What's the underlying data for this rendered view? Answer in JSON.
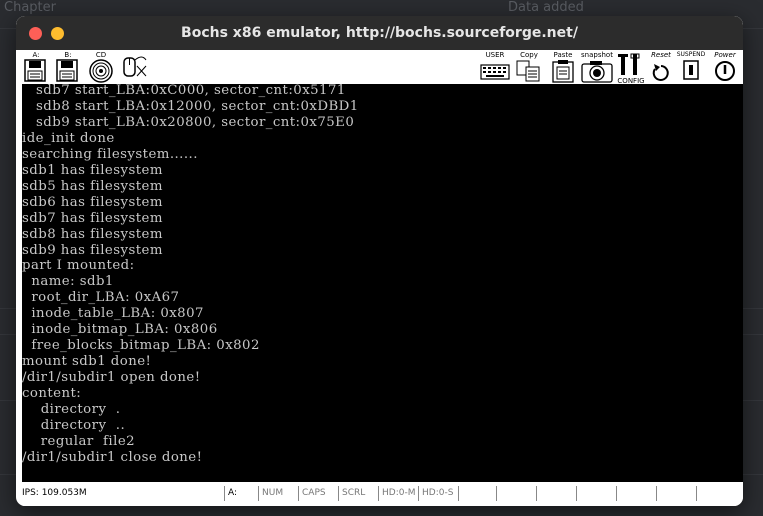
{
  "background": {
    "fragments": [
      "Data added",
      "Chapter"
    ]
  },
  "window": {
    "title": "Bochs x86 emulator, http://bochs.sourceforge.net/"
  },
  "toolbar": {
    "floppy_a": "A:",
    "floppy_b": "B:",
    "cdrom": "CD",
    "user": "USER",
    "copy": "Copy",
    "paste": "Paste",
    "snapshot": "snapshot",
    "config": "CONFIG",
    "reset": "Reset",
    "suspend": "SUSPEND",
    "power": "Power"
  },
  "console": {
    "lines": [
      "   sdb7 start_LBA:0xC000, sector_cnt:0x5171",
      "   sdb8 start_LBA:0x12000, sector_cnt:0xDBD1",
      "   sdb9 start_LBA:0x20800, sector_cnt:0x75E0",
      "ide_init done",
      "searching filesystem......",
      "sdb1 has filesystem",
      "sdb5 has filesystem",
      "sdb6 has filesystem",
      "sdb7 has filesystem",
      "sdb8 has filesystem",
      "sdb9 has filesystem",
      "part I mounted:",
      "  name: sdb1",
      "  root_dir_LBA: 0xA67",
      "  inode_table_LBA: 0x807",
      "  inode_bitmap_LBA: 0x806",
      "  free_blocks_bitmap_LBA: 0x802",
      "mount sdb1 done!",
      "/dir1/subdir1 open done!",
      "content:",
      "    directory  .",
      "    directory  ..",
      "    regular  file2",
      "/dir1/subdir1 close done!"
    ]
  },
  "status": {
    "ips": "IPS: 109.053M",
    "drive": "A:",
    "num": "NUM",
    "caps": "CAPS",
    "scrl": "SCRL",
    "hd0m": "HD:0-M",
    "hd0s": "HD:0-S"
  },
  "colors": {
    "console_bg": "#000000",
    "console_fg": "#c8c8c8",
    "titlebar": "#2c2c2c",
    "close": "#fe5f57",
    "minimize": "#febc2e"
  }
}
